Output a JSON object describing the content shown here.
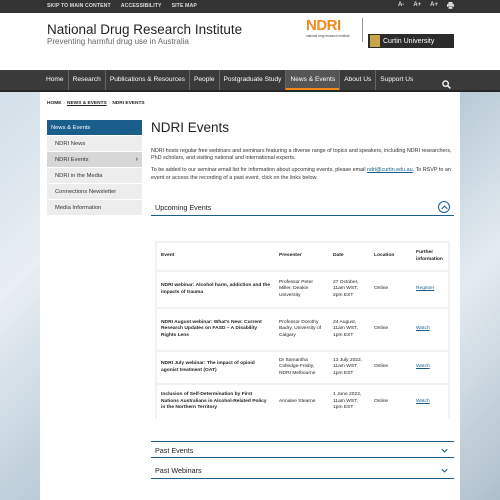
{
  "topbar": {
    "links": [
      "SKIP TO MAIN CONTENT",
      "ACCESSIBILITY",
      "SITE MAP"
    ],
    "tools": [
      "A-",
      "A+",
      "A+"
    ],
    "print_icon": "print-icon"
  },
  "header": {
    "site_title": "National Drug Research Institute",
    "tagline": "Preventing harmful drug use in Australia",
    "ndri_logo": "NDRI",
    "ndri_logo_sub": "national drug research institute",
    "curtin_logo": "Curtin University"
  },
  "nav": {
    "items": [
      "Home",
      "Research",
      "Publications & Resources",
      "People",
      "Postgraduate Study",
      "News & Events",
      "About Us",
      "Support Us"
    ],
    "active_index": 5,
    "search_icon": "search-icon"
  },
  "breadcrumb": [
    "HOME",
    "NEWS & EVENTS",
    "NDRI EVENTS"
  ],
  "sidebar": {
    "heading": "News & Events",
    "items": [
      "NDRI News",
      "NDRI Events",
      "NDRI in the Media",
      "Connections Newsletter",
      "Media Information"
    ],
    "current_index": 1
  },
  "main": {
    "title": "NDRI Events",
    "intro": "NDRI hosts regular free webinars and seminars featuring a diverse range of topics and speakers, including NDRI researchers, PhD scholars, and visiting national and international experts.",
    "intro2_before": "To be added to our seminar email list for information about upcoming events, please email",
    "intro2_email": "ndri@curtin.edu.au",
    "intro2_after": ". To RSVP to an event or access the recording of a past event, click on the links below."
  },
  "accordions": {
    "upcoming": "Upcoming Events",
    "past": "Past Events",
    "webinars": "Past Webinars"
  },
  "events_table": {
    "headers": [
      "Event",
      "Presenter",
      "Date",
      "Location",
      "Further information"
    ],
    "rows": [
      {
        "event": "NDRI webinar: Alcohol harm, addiction and the impacts of trauma",
        "presenter": "Professor Peter Miller, Deakin University",
        "date": "27 October, 11am WST, 2pm EST",
        "location": "Online",
        "link": "Register"
      },
      {
        "event": "NDRI August webinar: What's New: Current Research Updates on FASD – A Disability Rights Lens",
        "presenter": "Professor Dorothy Badry, University of Calgary",
        "date": "24 August, 11am WST, 1pm EST",
        "location": "Online",
        "link": "Watch"
      },
      {
        "event": "NDRI July webinar: The impact of opioid agonist treatment (OAT)",
        "presenter": "Dr Samantha Colledge-Frisby, NDRI Melbourne",
        "date": "13 July 2022, 11am WST, 1pm EST",
        "location": "Online",
        "link": "Watch"
      },
      {
        "event": "Inclusion of Self-Determination by First Nations Australians in Alcohol-Related Policy in the Northern Territory",
        "presenter": "Annalee Stearne",
        "date": "1 June 2022, 11am WST, 1pm EST",
        "location": "Online",
        "link": "Watch"
      }
    ]
  },
  "colors": {
    "accent_blue": "#1a5e8c",
    "ndri_orange": "#f08a1c",
    "nav_dark": "#3a3a3a"
  }
}
